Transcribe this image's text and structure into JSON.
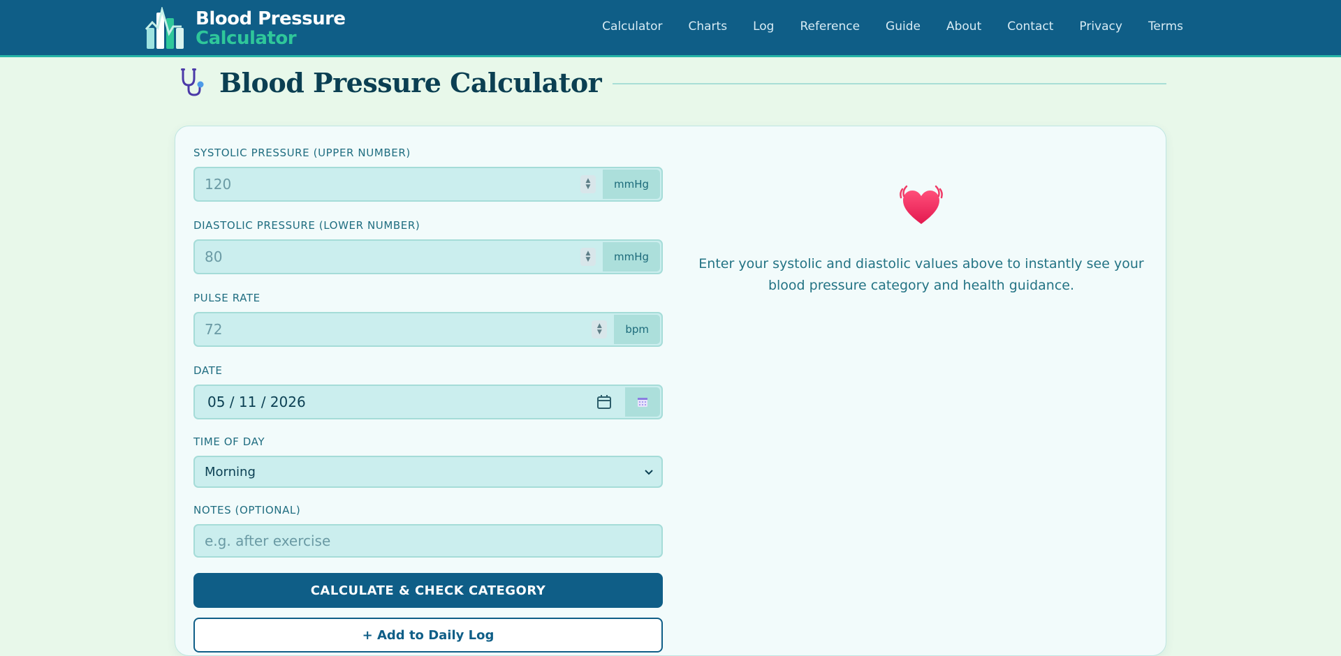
{
  "brand": {
    "line1": "Blood Pressure",
    "line2": "Calculator"
  },
  "nav": [
    "Calculator",
    "Charts",
    "Log",
    "Reference",
    "Guide",
    "About",
    "Contact",
    "Privacy",
    "Terms"
  ],
  "page": {
    "title": "Blood Pressure Calculator"
  },
  "form": {
    "systolic": {
      "label": "SYSTOLIC PRESSURE (UPPER NUMBER)",
      "placeholder": "120",
      "unit": "mmHg"
    },
    "diastolic": {
      "label": "DIASTOLIC PRESSURE (LOWER NUMBER)",
      "placeholder": "80",
      "unit": "mmHg"
    },
    "pulse": {
      "label": "PULSE RATE",
      "placeholder": "72",
      "unit": "bpm"
    },
    "date": {
      "label": "DATE",
      "value": "05 / 11 / 2026"
    },
    "time": {
      "label": "TIME OF DAY",
      "value": "Morning"
    },
    "notes": {
      "label": "NOTES (OPTIONAL)",
      "placeholder": "e.g. after exercise"
    },
    "calculate_label": "CALCULATE & CHECK CATEGORY",
    "log_label": "+ Add to Daily Log"
  },
  "result": {
    "message": "Enter your systolic and diastolic values above to instantly see your blood pressure category and health guidance."
  },
  "colors": {
    "header": "#0f5e87",
    "accent": "#2fc79a",
    "background": "#e8f8ea",
    "card": "#f2fbfb"
  }
}
